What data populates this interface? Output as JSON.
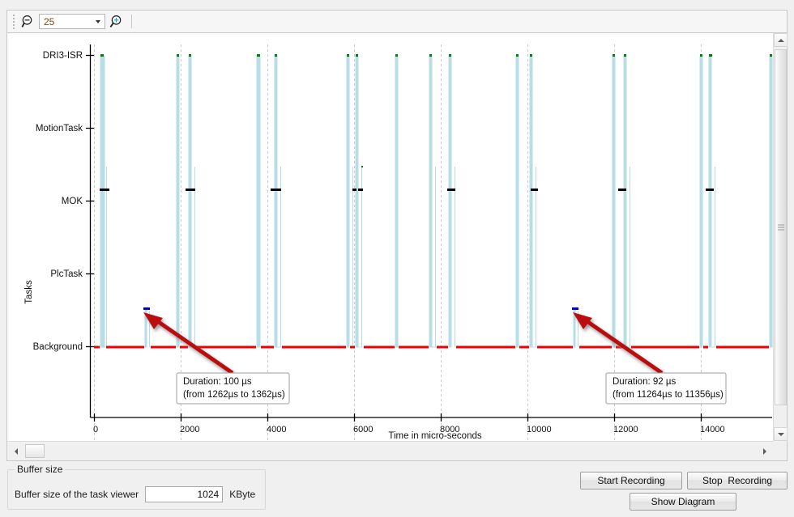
{
  "toolbar": {
    "zoom_out_icon": "zoom-out-magnifier",
    "zoom_in_icon": "zoom-in-magnifier",
    "zoom_value": "25",
    "zoom_options": [
      "25"
    ]
  },
  "chart_data": {
    "type": "line",
    "title": "",
    "xlabel": "Time in micro-seconds",
    "ylabel": "Tasks",
    "xlim": [
      0,
      15850
    ],
    "xticks": [
      0,
      2000,
      4000,
      6000,
      8000,
      10000,
      12000,
      14000
    ],
    "xticklabels": [
      "0",
      "2000",
      "4000",
      "6000",
      "8000",
      "10000",
      "12000",
      "14000"
    ],
    "yticklabels": [
      "DRI3-ISR",
      "MotionTask",
      "MOK",
      "PlcTask",
      "Background"
    ],
    "ylevels": [
      4,
      3,
      2,
      1,
      0
    ],
    "grid": "vertical-dashed",
    "series": [
      {
        "name": "Background",
        "color": "#ee0000",
        "level": "Background"
      },
      {
        "name": "Task activity",
        "color": "#b6dde8",
        "level": "pulse"
      },
      {
        "name": "DRI3-ISR marker",
        "color": "#008000"
      },
      {
        "name": "MOK marker",
        "color": "#000000"
      },
      {
        "name": "PlcTask marker",
        "color": "#0000cc"
      }
    ],
    "pulses": [
      {
        "t": 260,
        "top": "DRI3-ISR",
        "width": 6
      },
      {
        "t": 305,
        "top": "MotionTask",
        "width": 1
      },
      {
        "t": 1270,
        "top": "PlcTask",
        "width": 2
      },
      {
        "t": 2035,
        "top": "DRI3-ISR",
        "width": 3
      },
      {
        "t": 2135,
        "top": "DRI3-ISR",
        "width": 3
      },
      {
        "t": 2190,
        "top": "MotionTask",
        "width": 1
      },
      {
        "t": 3690,
        "top": "DRI3-ISR",
        "width": 4
      },
      {
        "t": 3790,
        "top": "MotionTask",
        "width": 2
      },
      {
        "t": 4255,
        "top": "DRI3-ISR",
        "width": 3
      },
      {
        "t": 4360,
        "top": "MotionTask",
        "width": 2
      },
      {
        "t": 5830,
        "top": "DRI3-ISR",
        "width": 3
      },
      {
        "t": 5930,
        "top": "MotionTask",
        "width": 2
      },
      {
        "t": 6430,
        "top": "DRI3-ISR",
        "width": 3
      },
      {
        "t": 6530,
        "top": "MotionTask",
        "width": 2
      },
      {
        "t": 8050,
        "top": "DRI3-ISR",
        "width": 3
      },
      {
        "t": 8150,
        "top": "MotionTask",
        "width": 2
      },
      {
        "t": 9230,
        "top": "PlcTask",
        "width": 2
      },
      {
        "t": 10050,
        "top": "DRI3-ISR",
        "width": 3
      },
      {
        "t": 10150,
        "top": "MotionTask",
        "width": 2
      },
      {
        "t": 11270,
        "top": "PlcTask",
        "width": 2
      },
      {
        "t": 12300,
        "top": "DRI3-ISR",
        "width": 3
      },
      {
        "t": 12400,
        "top": "MotionTask",
        "width": 2
      },
      {
        "t": 13900,
        "top": "DRI3-ISR",
        "width": 3
      },
      {
        "t": 14000,
        "top": "MotionTask",
        "width": 2
      },
      {
        "t": 15700,
        "top": "DRI3-ISR",
        "width": 2
      }
    ],
    "annotations": [
      {
        "name": "annotation-1",
        "line1": "Duration: 100 µs",
        "line2": "(from 1262µs to 1362µs)",
        "arrow_color": "#bb1111"
      },
      {
        "name": "annotation-2",
        "line1": "Duration: 92 µs",
        "line2": "(from 11264µs to 11356µs)",
        "arrow_color": "#bb1111"
      }
    ]
  },
  "buffer": {
    "group_title": "Buffer size",
    "label": "Buffer size of the task viewer",
    "value": "1024",
    "unit": "KByte"
  },
  "buttons": {
    "start": "Start Recording",
    "stop": "Stop  Recording",
    "show": "Show Diagram"
  },
  "scrollbars": {
    "vertical_up_icon": "triangle-up-icon",
    "vertical_down_icon": "triangle-down-icon",
    "horizontal_left_icon": "triangle-left-icon",
    "horizontal_right_icon": "triangle-right-icon"
  }
}
